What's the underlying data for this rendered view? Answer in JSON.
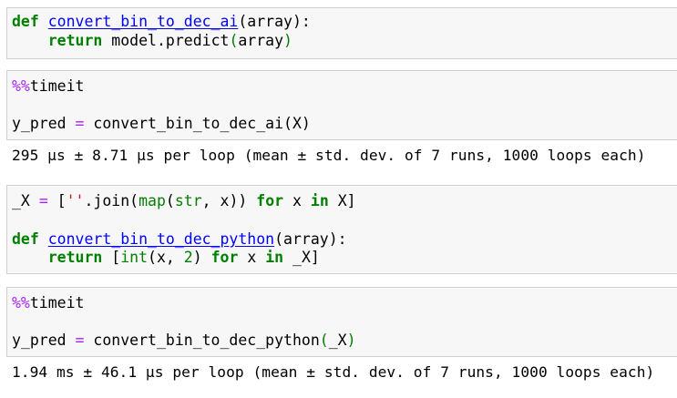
{
  "cells": [
    {
      "lines": [
        [
          [
            "kw",
            "def"
          ],
          [
            "tx",
            " "
          ],
          [
            "fn",
            "convert_bin_to_dec_ai"
          ],
          [
            "tx",
            "(array):"
          ]
        ],
        [
          [
            "tx",
            "    "
          ],
          [
            "kw",
            "return"
          ],
          [
            "tx",
            " model.predict"
          ],
          [
            "bi",
            "("
          ],
          [
            "tx",
            "array"
          ],
          [
            "bi",
            ")"
          ]
        ]
      ]
    },
    {
      "lines": [
        [
          [
            "mg",
            "%%"
          ],
          [
            "tx",
            "timeit"
          ]
        ],
        [],
        [
          [
            "tx",
            "y_pred "
          ],
          [
            "op",
            "="
          ],
          [
            "tx",
            " convert_bin_to_dec_ai(X)"
          ]
        ]
      ]
    },
    {
      "lines": [
        [
          [
            "tx",
            "_X "
          ],
          [
            "op",
            "="
          ],
          [
            "tx",
            " ["
          ],
          [
            "st",
            "''"
          ],
          [
            "tx",
            ".join("
          ],
          [
            "bi",
            "map"
          ],
          [
            "tx",
            "("
          ],
          [
            "bi",
            "str"
          ],
          [
            "tx",
            ", x)) "
          ],
          [
            "kw",
            "for"
          ],
          [
            "tx",
            " x "
          ],
          [
            "kw",
            "in"
          ],
          [
            "tx",
            " X]"
          ]
        ],
        [],
        [
          [
            "kw",
            "def"
          ],
          [
            "tx",
            " "
          ],
          [
            "fn",
            "convert_bin_to_dec_python"
          ],
          [
            "tx",
            "(array):"
          ]
        ],
        [
          [
            "tx",
            "    "
          ],
          [
            "kw",
            "return"
          ],
          [
            "tx",
            " ["
          ],
          [
            "bi",
            "int"
          ],
          [
            "tx",
            "(x, "
          ],
          [
            "nu",
            "2"
          ],
          [
            "tx",
            ") "
          ],
          [
            "kw",
            "for"
          ],
          [
            "tx",
            " x "
          ],
          [
            "kw",
            "in"
          ],
          [
            "tx",
            " _X]"
          ]
        ]
      ]
    },
    {
      "lines": [
        [
          [
            "mg",
            "%%"
          ],
          [
            "tx",
            "timeit"
          ]
        ],
        [],
        [
          [
            "tx",
            "y_pred "
          ],
          [
            "op",
            "="
          ],
          [
            "tx",
            " convert_bin_to_dec_python"
          ],
          [
            "bi",
            "("
          ],
          [
            "tx",
            "_X"
          ],
          [
            "bi",
            ")"
          ]
        ]
      ]
    }
  ],
  "outputs": [
    "295 µs ± 8.71 µs per loop (mean ± std. dev. of 7 runs, 1000 loops each)",
    "1.94 ms ± 46.1 µs per loop (mean ± std. dev. of 7 runs, 1000 loops each)"
  ]
}
